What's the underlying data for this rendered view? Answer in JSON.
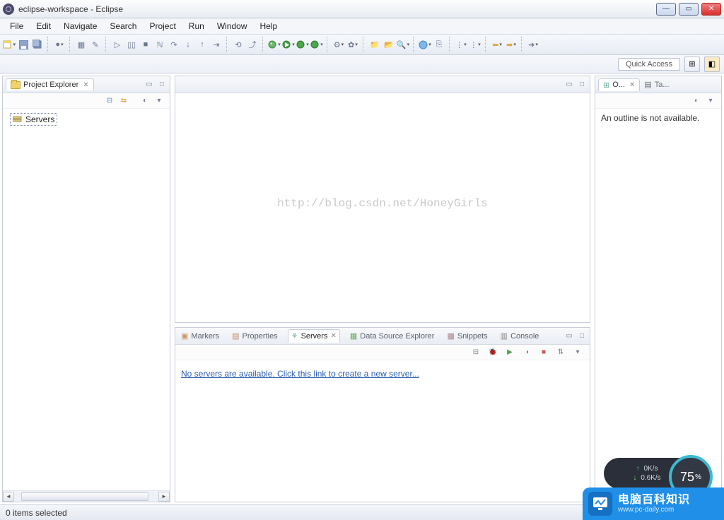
{
  "title": "eclipse-workspace - Eclipse",
  "menu": {
    "file": "File",
    "edit": "Edit",
    "navigate": "Navigate",
    "search": "Search",
    "project": "Project",
    "run": "Run",
    "window": "Window",
    "help": "Help"
  },
  "quickAccess": "Quick Access",
  "projectExplorer": {
    "title": "Project Explorer",
    "items": [
      "Servers"
    ]
  },
  "outline": {
    "tab1": "O...",
    "tab2": "Ta...",
    "empty": "An outline is not available."
  },
  "editor": {
    "watermark": "http://blog.csdn.net/HoneyGirls"
  },
  "bottom": {
    "tabs": {
      "markers": "Markers",
      "properties": "Properties",
      "servers": "Servers",
      "dse": "Data Source Explorer",
      "snippets": "Snippets",
      "console": "Console"
    },
    "noServers": "No servers are available. Click this link to create a new server..."
  },
  "status": {
    "selected": "0 items selected"
  },
  "netmon": {
    "up": "0K/s",
    "down": "0.6K/s",
    "pct": "75"
  },
  "badge": {
    "main": "电脑百科知识",
    "sub": "www.pc-daily.com"
  }
}
